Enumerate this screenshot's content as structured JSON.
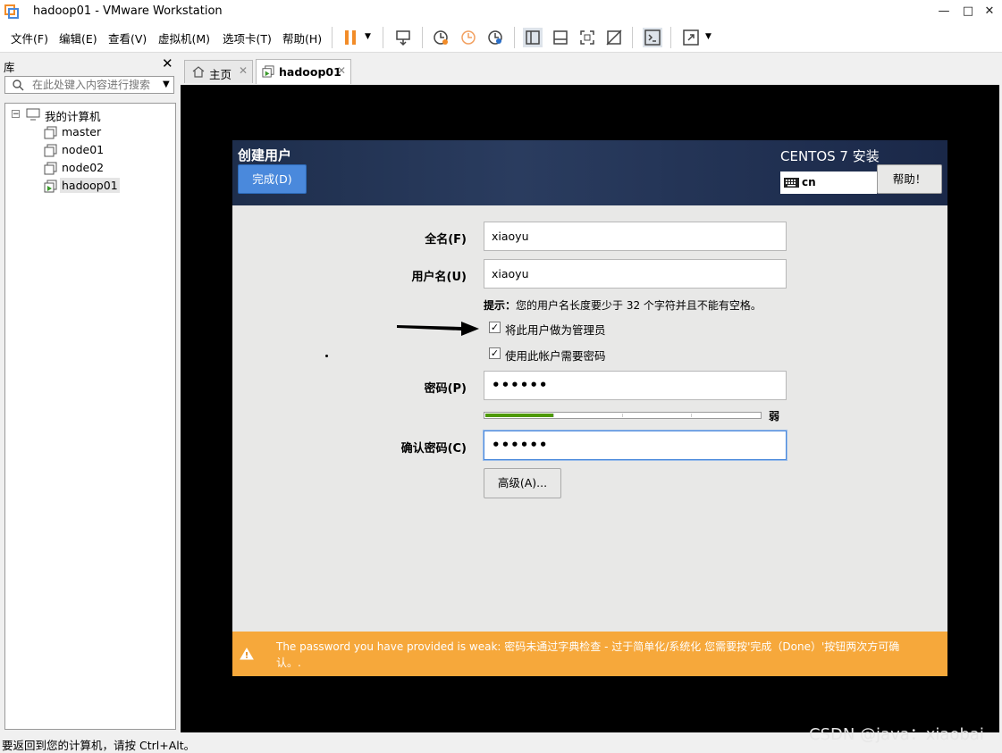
{
  "window": {
    "title": "hadoop01 - VMware Workstation",
    "minimize": "—",
    "maximize": "□",
    "close": "✕"
  },
  "menu": [
    "文件(F)",
    "编辑(E)",
    "查看(V)",
    "虚拟机(M)",
    "选项卡(T)",
    "帮助(H)"
  ],
  "library": {
    "title": "库",
    "close": "✕",
    "search_placeholder": "在此处键入内容进行搜索",
    "root": "我的计算机",
    "vms": [
      "master",
      "node01",
      "node02",
      "hadoop01"
    ],
    "selected_vm": "hadoop01"
  },
  "tabs": [
    {
      "label": "主页",
      "icon": "home-icon"
    },
    {
      "label": "hadoop01",
      "icon": "vm-running-icon",
      "active": true
    }
  ],
  "installer": {
    "title": "创建用户",
    "done_button": "完成(D)",
    "product": "CENTOS 7 安装",
    "keyboard_layout": "cn",
    "help_button": "帮助！",
    "fullname_label": "全名(F)",
    "fullname_value": "xiaoyu",
    "username_label": "用户名(U)",
    "username_value": "xiaoyu",
    "hint_prefix": "提示：",
    "hint_text": "您的用户名长度要少于 32 个字符并且不能有空格。",
    "admin_checkbox_label": "将此用户做为管理员",
    "admin_checked": true,
    "require_password_label": "使用此帐户需要密码",
    "require_password_checked": true,
    "password_label": "密码(P)",
    "password_value": "••••••",
    "strength_label": "弱",
    "strength_fraction": 0.25,
    "confirm_label": "确认密码(C)",
    "confirm_value": "••••••",
    "advanced_button": "高级(A)...",
    "warning_line1": "The password you have provided is weak: 密码未通过字典检查 - 过于简单化/系统化 您需要按'完成（Done）'按钮两次方可确",
    "warning_line2": "认。."
  },
  "status": {
    "text": "要返回到您的计算机，请按 Ctrl+Alt。"
  },
  "watermark": "CSDN @java：xiaobai",
  "colors": {
    "accent": "#4a89dc",
    "warning": "#f6a83b",
    "header_dark": "#1e2e4c",
    "pause": "#f28c28"
  }
}
